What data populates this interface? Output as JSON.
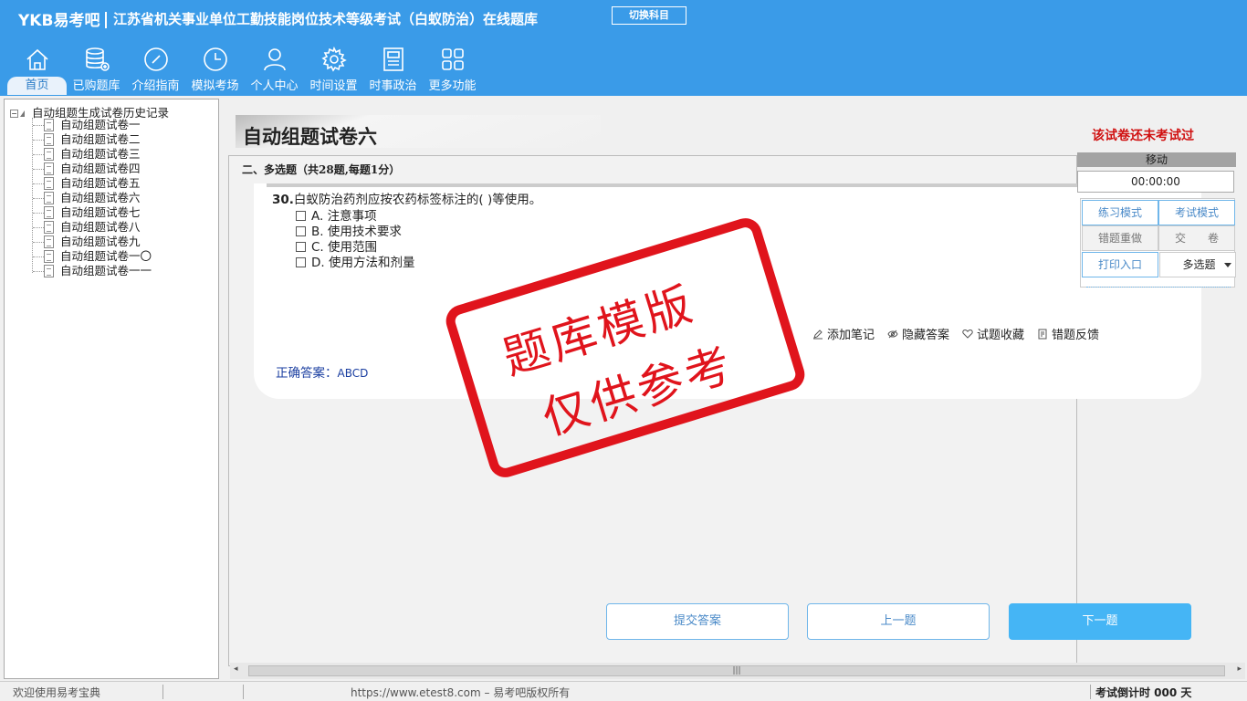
{
  "header": {
    "logo": "YKB易考吧",
    "title": "江苏省机关事业单位工勤技能岗位技术等级考试（白蚁防治）在线题库",
    "switch_button": "切换科目"
  },
  "nav": [
    {
      "label": "首页",
      "icon": "home-icon",
      "active": true
    },
    {
      "label": "已购题库",
      "icon": "database-icon"
    },
    {
      "label": "介绍指南",
      "icon": "compass-icon"
    },
    {
      "label": "模拟考场",
      "icon": "clock-icon"
    },
    {
      "label": "个人中心",
      "icon": "user-icon"
    },
    {
      "label": "时间设置",
      "icon": "gear-icon"
    },
    {
      "label": "时事政治",
      "icon": "newspaper-icon"
    },
    {
      "label": "更多功能",
      "icon": "grid-icon"
    }
  ],
  "tree": {
    "root": "自动组题生成试卷历史记录",
    "items": [
      "自动组题试卷一",
      "自动组题试卷二",
      "自动组题试卷三",
      "自动组题试卷四",
      "自动组题试卷五",
      "自动组题试卷六",
      "自动组题试卷七",
      "自动组题试卷八",
      "自动组题试卷九",
      "自动组题试卷一〇",
      "自动组题试卷一一"
    ]
  },
  "paper": {
    "title": "自动组题试卷六",
    "status": "该试卷还未考试过",
    "section": "二、多选题（共28题,每题1分）"
  },
  "question": {
    "number": "30.",
    "text": "白蚁防治药剂应按农药标签标注的( )等使用。",
    "options": [
      "A. 注意事项",
      "B. 使用技术要求",
      "C. 使用范围",
      "D. 使用方法和剂量"
    ],
    "answer_label": "正确答案：",
    "answer_value": "ABCD"
  },
  "tools": {
    "note": "添加笔记",
    "hide": "隐藏答案",
    "favorite": "试题收藏",
    "feedback": "错题反馈"
  },
  "stamp": {
    "line1": "题库模版",
    "line2": "仅供参考"
  },
  "buttons": {
    "submit": "提交答案",
    "prev": "上一题",
    "next": "下一题"
  },
  "control": {
    "move": "移动",
    "timer": "00:00:00",
    "practice_mode": "练习模式",
    "exam_mode": "考试模式",
    "redo_wrong": "错题重做",
    "hand_in": "交　　卷",
    "print": "打印入口",
    "type_selected": "多选题"
  },
  "statusbar": {
    "welcome": "欢迎使用易考宝典",
    "copyright": "https://www.etest8.com – 易考吧版权所有",
    "countdown": "考试倒计时 000 天"
  },
  "colors": {
    "header_bg": "#3a9be8",
    "stamp": "#e0141c",
    "next_button": "#45b5f5",
    "status_red": "#d01010"
  }
}
